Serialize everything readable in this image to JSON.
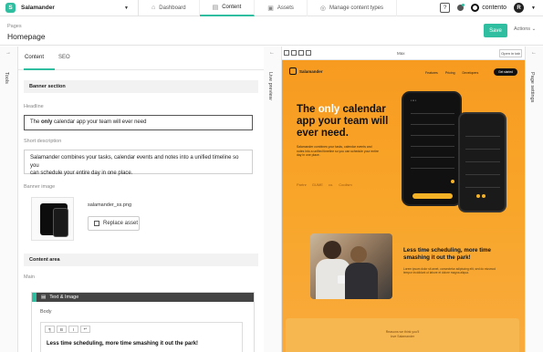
{
  "topbar": {
    "workspace_initial": "S",
    "workspace_name": "Salamander",
    "tabs": [
      {
        "label": "Dashboard",
        "icon": "house-icon"
      },
      {
        "label": "Content",
        "icon": "document-icon"
      },
      {
        "label": "Assets",
        "icon": "image-icon"
      },
      {
        "label": "Manage content types",
        "icon": "content-types-icon"
      }
    ],
    "brand": "contento",
    "avatar_initial": "R",
    "accent_color": "#2fbfa0"
  },
  "page": {
    "breadcrumb": "Pages",
    "title": "Homepage",
    "save_label": "Save",
    "actions_label": "Actions"
  },
  "rails": {
    "left": "Tools",
    "middle": "Live preview",
    "right": "Page settings"
  },
  "editor": {
    "tabs": [
      "Content",
      "SEO"
    ],
    "banner_section": "Banner section",
    "headline_label": "Headline",
    "headline": {
      "pre": "The ",
      "bold": "only",
      "post": " calendar app your team will ever need"
    },
    "short_desc_label": "Short description",
    "short_desc_line1": "Salamander combines your tasks, calendar events and notes into a unified timeline so you",
    "short_desc_line2": "can schedule your entire day in one place.",
    "banner_image_label": "Banner image",
    "banner_file": "salamander_ss.png",
    "replace_label": "Replace asset",
    "content_area": "Content area",
    "main_label": "Main",
    "block_type": "Text & Image",
    "body_label": "Body",
    "rte_tools": [
      "¶",
      "B",
      "I",
      "↩"
    ],
    "body_text": "Less time scheduling, more time smashing it out the park!"
  },
  "preview": {
    "size_label": "Max",
    "open_tab": "Open in tab",
    "site_name": "Salamander",
    "nav": [
      "Features",
      "Pricing",
      "Developers"
    ],
    "cta": "Get started",
    "hero_pre": "The ",
    "hero_only": "only",
    "hero_post": " calendar app your team will ever need.",
    "hero_sub": "Salamander combines your tasks, calendar events and notes into a unified timeline so you can schedule your entire day in one place.",
    "logos": [
      "Partnr",
      "GUME",
      "co.",
      "Coolism"
    ],
    "section2_heading": "Less time scheduling, more time smashing it out the park!",
    "section2_sub": "Lorem ipsum dolor sit amet, consectetur adipiscing elit, sed do eiusmod tempor incididunt ut labore et dolore magna aliqua.",
    "bottom_line1": "Reasons we think you'll",
    "bottom_line2": "love Salamander"
  }
}
